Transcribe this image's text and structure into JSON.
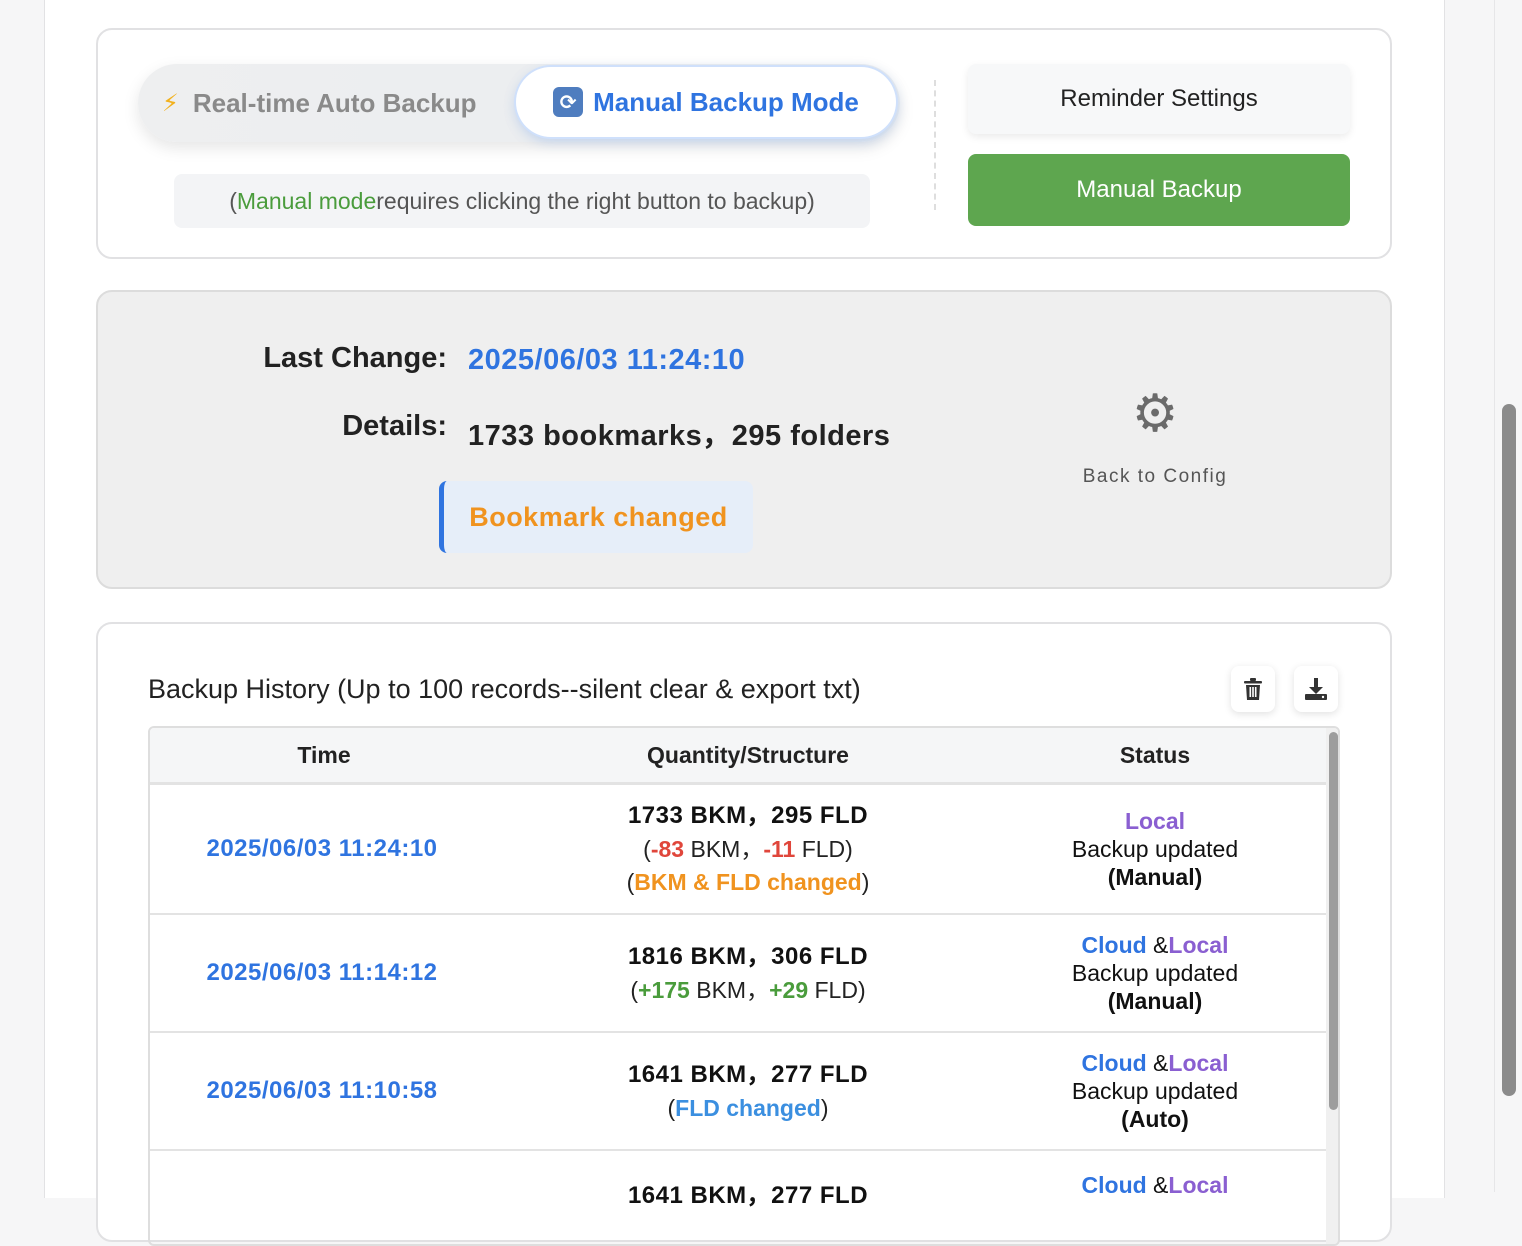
{
  "mode": {
    "realtime_icon": "bolt-icon",
    "realtime_label": "Real-time Auto Backup",
    "manual_icon": "sync-icon",
    "manual_label": "Manual Backup Mode",
    "hint_open": "(",
    "hint_highlight": "Manual mode",
    "hint_rest": " requires clicking the right button to backup)",
    "reminder_button": "Reminder Settings",
    "manual_backup_button": "Manual Backup"
  },
  "status": {
    "last_change_label": "Last Change:",
    "last_change_value": "2025/06/03 11:24:10",
    "details_label": "Details:",
    "details_value": "1733 bookmarks，295 folders",
    "badge": "Bookmark changed",
    "config_icon": "gear-icon",
    "config_label": "Back to Config"
  },
  "history": {
    "title": "Backup History (Up to 100 records--silent clear & export txt)",
    "clear_icon": "trash-icon",
    "export_icon": "download-icon",
    "columns": [
      "Time",
      "Quantity/Structure",
      "Status"
    ],
    "rows": [
      {
        "time": "2025/06/03 11:24:10",
        "counts": "1733 BKM，295 FLD",
        "diff_bkm": "-83",
        "diff_fld": "-11",
        "note": "BKM & FLD changed",
        "status_cloud": "",
        "status_local": "Local",
        "status_text": "Backup updated",
        "status_mode": "(Manual)"
      },
      {
        "time": "2025/06/03 11:14:12",
        "counts": "1816 BKM，306 FLD",
        "diff_bkm": "+175",
        "diff_fld": "+29",
        "status_cloud": "Cloud",
        "status_local": "Local",
        "status_text": "Backup updated",
        "status_mode": "(Manual)"
      },
      {
        "time": "2025/06/03 11:10:58",
        "counts": "1641 BKM，277 FLD",
        "note": "FLD changed",
        "status_cloud": "Cloud",
        "status_local": "Local",
        "status_text": "Backup updated",
        "status_mode": "(Auto)"
      },
      {
        "counts": "1641 BKM，277 FLD",
        "status_cloud": "Cloud",
        "status_local": "Local"
      }
    ]
  },
  "colors": {
    "accent_blue": "#2f74e0",
    "green": "#5ea64f",
    "orange": "#f0931f",
    "red": "#e0463b",
    "purple": "#8a5fd1"
  }
}
